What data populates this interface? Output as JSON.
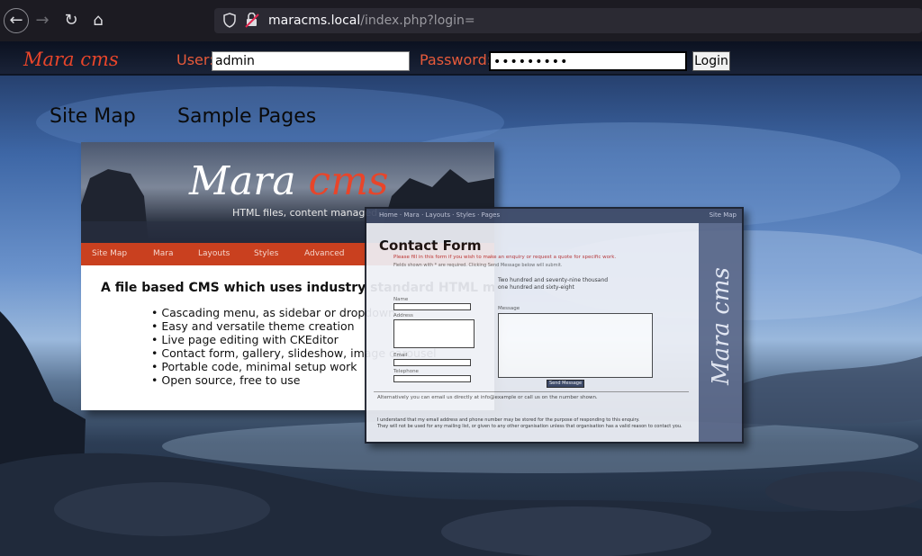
{
  "browser": {
    "url_host": "maracms.local",
    "url_path": "/index.php?login="
  },
  "loginbar": {
    "brand": "Mara cms",
    "user_label": "User:",
    "user_value": "admin",
    "password_label": "Password:",
    "password_value": "•••••••••",
    "login_button": "Login"
  },
  "nav": {
    "items": [
      {
        "label": "Site Map"
      },
      {
        "label": "Sample Pages"
      }
    ]
  },
  "screenshot1": {
    "logo_main": "Mara ",
    "logo_accent": "cms",
    "tagline": "HTML files, content managed",
    "menu": [
      "Site Map",
      "Mara",
      "Layouts",
      "Styles",
      "Advanced"
    ],
    "heading": "A file based CMS which uses industry standard HTML markup",
    "features": [
      "Cascading menu, as sidebar or dropdown",
      "Easy and versatile theme creation",
      "Live page editing with CKEditor",
      "Contact form, gallery, slideshow, image carousel",
      "Portable code, minimal setup work",
      "Open source, free to use"
    ]
  },
  "screenshot2": {
    "top_left": "Home  ·  Mara  ·  Layouts  ·  Styles  ·  Pages",
    "top_right": "Site Map",
    "title": "Contact Form",
    "intro": "Please fill in this form if you wish to make an enquiry or request a quote for specific work.",
    "intro2": "Fields shown with * are required. Clicking Send Message below will submit.",
    "field_labels": [
      "Name",
      "Address",
      "Email",
      "Telephone"
    ],
    "note": "Two hundred and seventy-nine thousand\none hundred and sixty-eight",
    "message_label": "Message",
    "send_button": "Send Message",
    "alt_text": "Alternatively you can email us directly at info@example or call us on the number shown.",
    "footer": "I understand that my email address and phone number may be stored for the purpose of responding to this enquiry.\nThey will not be used for any mailing list, or given to any other organisation unless that organisation has a valid reason to contact you.",
    "sidebar_logo": "Mara cms"
  }
}
